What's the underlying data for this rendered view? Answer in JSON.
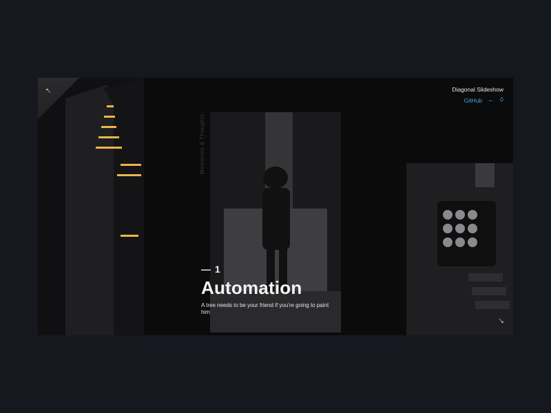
{
  "brand": {
    "title": "Diagonal Slideshow",
    "github_label": "GitHub",
    "back_icon": "arrow-left-icon",
    "codrops_icon": "drop-icon"
  },
  "nav": {
    "prev_icon": "arrow-up-left-icon",
    "next_icon": "arrow-down-right-icon"
  },
  "slide": {
    "number": "— 1",
    "title": "Automation",
    "description": "A tree needs to be your friend if you're going to paint him",
    "vertical_caption": "Memories & Thoughts"
  },
  "colors": {
    "background": "#161820",
    "frame": "#0b0b0c",
    "accent": "#4aa3df",
    "text": "#f4f4f4"
  }
}
